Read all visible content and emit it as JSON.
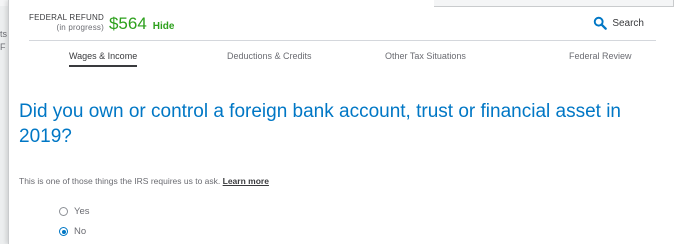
{
  "background": {
    "fragment_lines": [
      "ts",
      "F"
    ]
  },
  "header": {
    "refund_label": "FEDERAL REFUND",
    "refund_status": "(in progress)",
    "refund_amount": "$564",
    "hide_label": "Hide",
    "search_label": "Search",
    "accent_color": "#2ca01c"
  },
  "tabs": [
    {
      "label": "Wages & Income",
      "active": true
    },
    {
      "label": "Deductions & Credits",
      "active": false
    },
    {
      "label": "Other Tax Situations",
      "active": false
    },
    {
      "label": "Federal Review",
      "active": false
    }
  ],
  "question": {
    "text": "Did you own or control a foreign bank account, trust or financial asset in 2019?",
    "color": "#0077c5"
  },
  "helper": {
    "text": "This is one of those things the IRS requires us to ask. ",
    "link_label": "Learn more"
  },
  "options": [
    {
      "label": "Yes",
      "selected": false
    },
    {
      "label": "No",
      "selected": true
    }
  ]
}
